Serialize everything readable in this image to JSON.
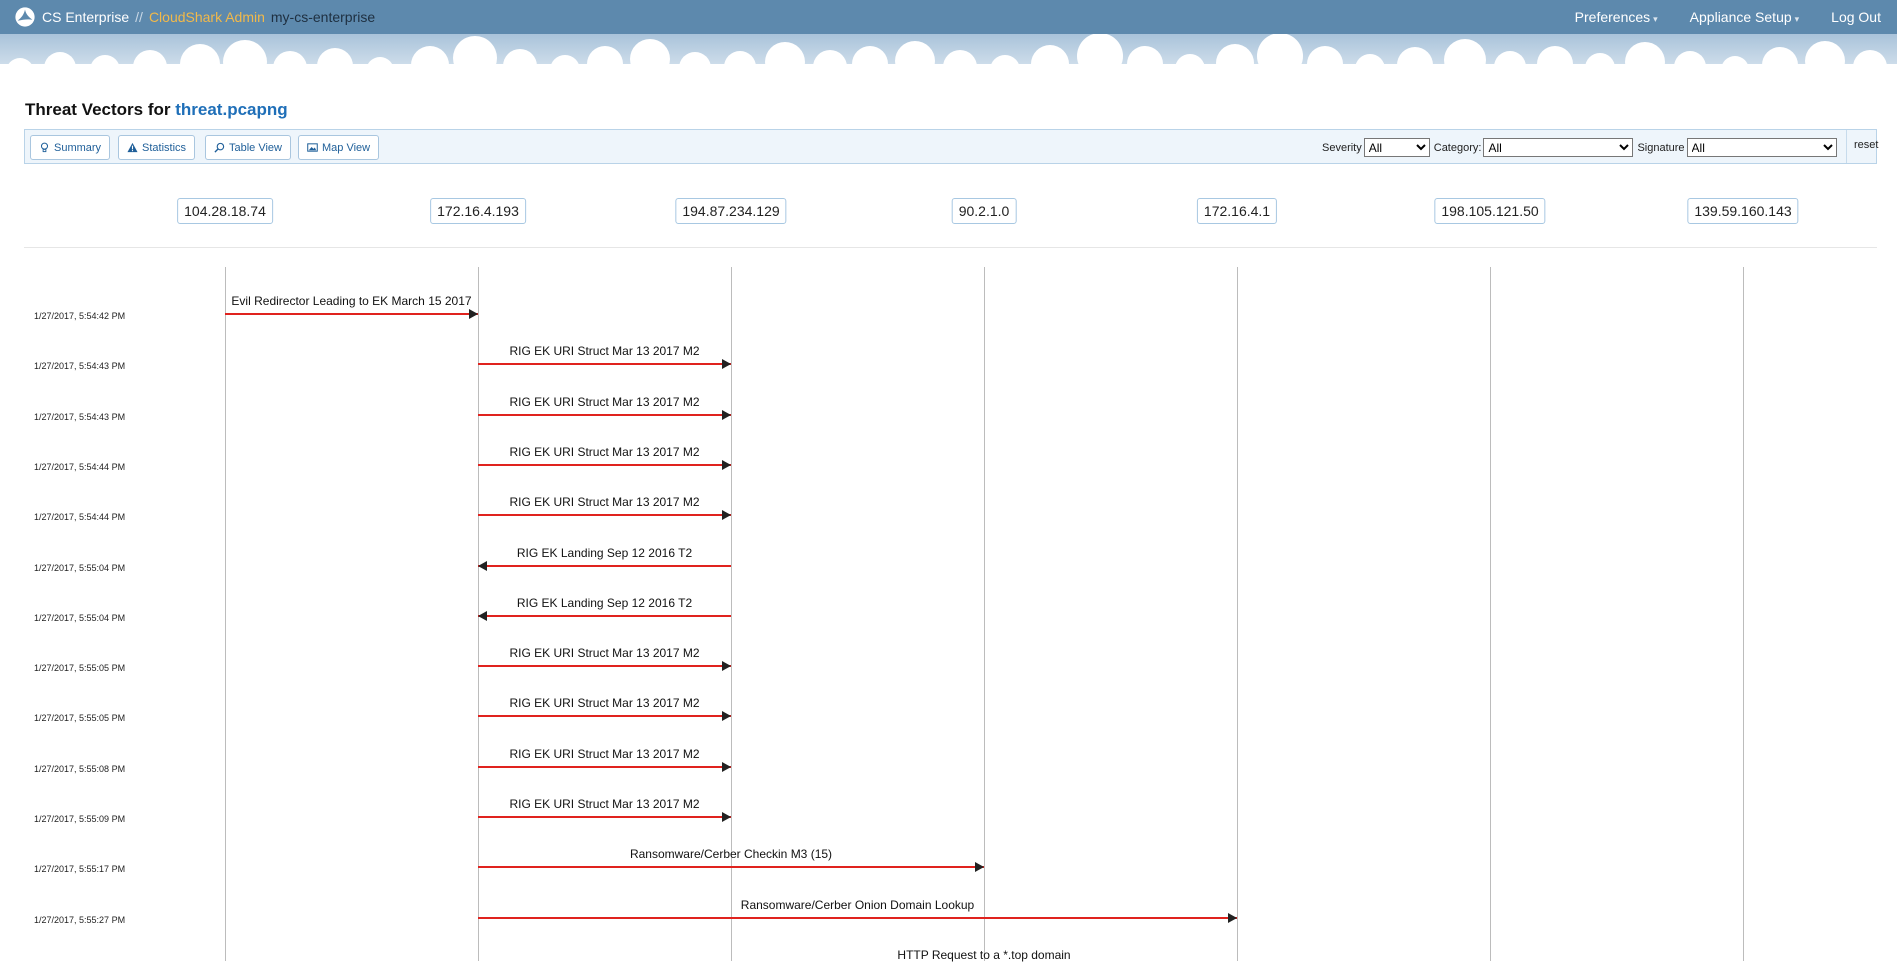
{
  "navbar": {
    "product": "CS Enterprise",
    "separator": "//",
    "admin_link": "CloudShark Admin",
    "host_name": "my-cs-enterprise",
    "preferences": "Preferences",
    "appliance_setup": "Appliance Setup",
    "logout": "Log Out"
  },
  "title": {
    "prefix": "Threat Vectors for",
    "file": "threat.pcapng"
  },
  "toolbar": {
    "summary": "Summary",
    "statistics": "Statistics",
    "table_view": "Table View",
    "map_view": "Map View",
    "severity_label": "Severity",
    "severity_value": "All",
    "category_label": "Category:",
    "category_value": "All",
    "signature_label": "Signature",
    "signature_value": "All",
    "reset": "reset"
  },
  "hosts": [
    "104.28.18.74",
    "172.16.4.193",
    "194.87.234.129",
    "90.2.1.0",
    "172.16.4.1",
    "198.105.121.50",
    "139.59.160.143"
  ],
  "events": [
    {
      "time": "1/27/2017, 5:54:42 PM",
      "label": "Evil Redirector Leading to EK March 15 2017",
      "from": 0,
      "to": 1
    },
    {
      "time": "1/27/2017, 5:54:43 PM",
      "label": "RIG EK URI Struct Mar 13 2017 M2",
      "from": 1,
      "to": 2
    },
    {
      "time": "1/27/2017, 5:54:43 PM",
      "label": "RIG EK URI Struct Mar 13 2017 M2",
      "from": 1,
      "to": 2
    },
    {
      "time": "1/27/2017, 5:54:44 PM",
      "label": "RIG EK URI Struct Mar 13 2017 M2",
      "from": 1,
      "to": 2
    },
    {
      "time": "1/27/2017, 5:54:44 PM",
      "label": "RIG EK URI Struct Mar 13 2017 M2",
      "from": 1,
      "to": 2
    },
    {
      "time": "1/27/2017, 5:55:04 PM",
      "label": "RIG EK Landing Sep 12 2016 T2",
      "from": 2,
      "to": 1
    },
    {
      "time": "1/27/2017, 5:55:04 PM",
      "label": "RIG EK Landing Sep 12 2016 T2",
      "from": 2,
      "to": 1
    },
    {
      "time": "1/27/2017, 5:55:05 PM",
      "label": "RIG EK URI Struct Mar 13 2017 M2",
      "from": 1,
      "to": 2
    },
    {
      "time": "1/27/2017, 5:55:05 PM",
      "label": "RIG EK URI Struct Mar 13 2017 M2",
      "from": 1,
      "to": 2
    },
    {
      "time": "1/27/2017, 5:55:08 PM",
      "label": "RIG EK URI Struct Mar 13 2017 M2",
      "from": 1,
      "to": 2
    },
    {
      "time": "1/27/2017, 5:55:09 PM",
      "label": "RIG EK URI Struct Mar 13 2017 M2",
      "from": 1,
      "to": 2
    },
    {
      "time": "1/27/2017, 5:55:17 PM",
      "label": "Ransomware/Cerber Checkin M3 (15)",
      "from": 1,
      "to": 3
    },
    {
      "time": "1/27/2017, 5:55:27 PM",
      "label": "Ransomware/Cerber Onion Domain Lookup",
      "from": 1,
      "to": 4
    },
    {
      "time": "",
      "label": "HTTP Request to a *.top domain",
      "from": 1,
      "to": 5
    }
  ],
  "colors": {
    "navbar": "#5d89ad",
    "accent": "#f2b94a",
    "link": "#1f6fb8",
    "arrow": "#e0231e"
  }
}
